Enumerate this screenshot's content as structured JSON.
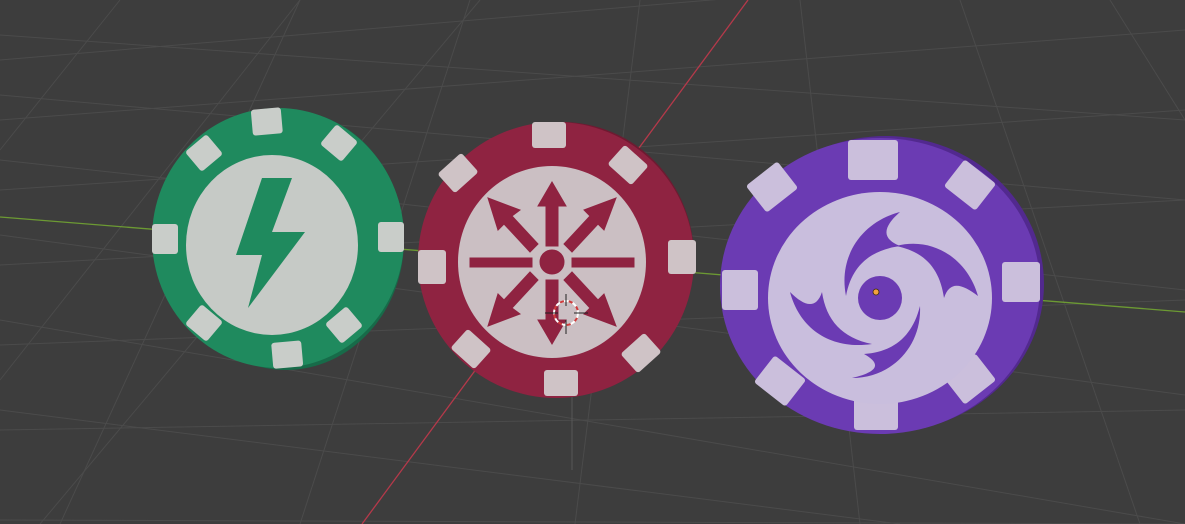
{
  "app": {
    "name": "3D Viewport"
  },
  "viewport": {
    "background_color": "#3d3d3d",
    "grid_color": "#4a4a4a",
    "x_axis_color": "#b5394a",
    "y_axis_color": "#6c9a33",
    "cursor_icon": "3d-cursor-icon",
    "origin_icon": "object-origin-icon",
    "origin_color": "#f4a23c"
  },
  "objects": [
    {
      "name": "poker-chip-green",
      "body_color": "#1f8a5e",
      "edge_color": "#176b49",
      "stripe_color": "#c9cdc9",
      "emblem_icon": "lightning-bolt-icon"
    },
    {
      "name": "poker-chip-red",
      "body_color": "#8f2341",
      "edge_color": "#6e1a31",
      "stripe_color": "#cfc3c6",
      "emblem_icon": "chaos-star-icon"
    },
    {
      "name": "poker-chip-purple",
      "body_color": "#6b3bb3",
      "edge_color": "#52298f",
      "stripe_color": "#cbbfdc",
      "emblem_icon": "swirl-vortex-icon"
    }
  ]
}
